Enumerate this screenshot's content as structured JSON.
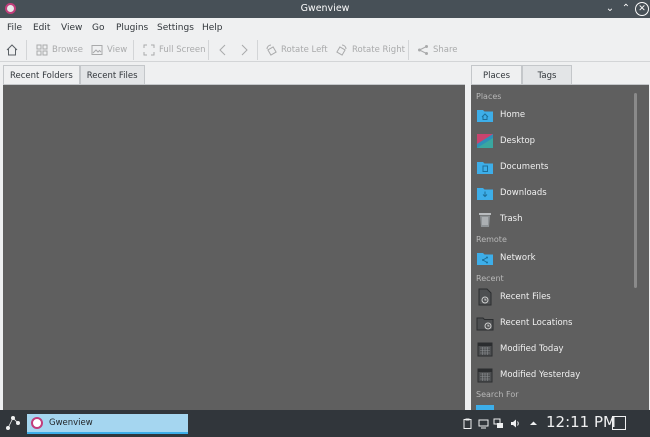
{
  "window": {
    "title": "Gwenview",
    "controls": [
      "minimize",
      "maximize",
      "close"
    ]
  },
  "menu": [
    "File",
    "Edit",
    "View",
    "Go",
    "Plugins",
    "Settings",
    "Help"
  ],
  "toolbar": {
    "browse": "Browse",
    "view": "View",
    "fullscreen": "Full Screen",
    "rotate_left": "Rotate Left",
    "rotate_right": "Rotate Right",
    "share": "Share"
  },
  "left_tabs": [
    "Recent Folders",
    "Recent Files"
  ],
  "right_tabs": [
    "Places",
    "Tags"
  ],
  "places": {
    "sections": {
      "places": "Places",
      "remote": "Remote",
      "recent": "Recent",
      "search": "Search For"
    },
    "items": [
      {
        "label": "Home",
        "icon": "home-folder-icon"
      },
      {
        "label": "Desktop",
        "icon": "desktop-icon"
      },
      {
        "label": "Documents",
        "icon": "documents-folder-icon"
      },
      {
        "label": "Downloads",
        "icon": "downloads-folder-icon"
      },
      {
        "label": "Trash",
        "icon": "trash-icon"
      },
      {
        "label": "Network",
        "icon": "network-folder-icon"
      },
      {
        "label": "Recent Files",
        "icon": "recent-files-icon"
      },
      {
        "label": "Recent Locations",
        "icon": "recent-locations-icon"
      },
      {
        "label": "Modified Today",
        "icon": "calendar-icon"
      },
      {
        "label": "Modified Yesterday",
        "icon": "calendar-icon"
      }
    ]
  },
  "taskbar": {
    "task_label": "Gwenview",
    "clock": "12:11 PM"
  },
  "colors": {
    "accent": "#3daee9",
    "folder": "#3daee9",
    "titlebar": "#475057",
    "panel_bg": "#5f5f5f"
  }
}
